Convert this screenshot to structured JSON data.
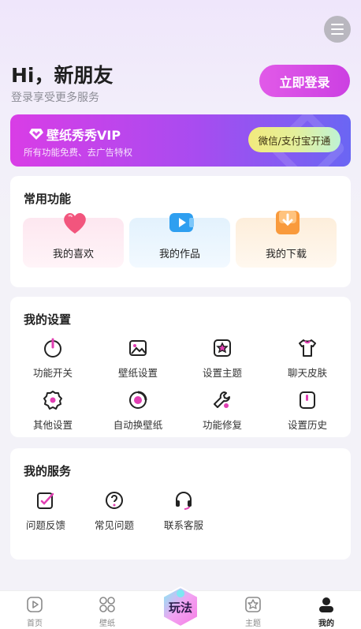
{
  "header": {
    "greeting": "Hi，新朋友",
    "subtitle": "登录享受更多服务",
    "login_label": "立即登录"
  },
  "vip": {
    "title": "壁纸秀秀VIP",
    "subtitle": "所有功能免费、去广告特权",
    "button_label": "微信/支付宝开通"
  },
  "common": {
    "title": "常用功能",
    "items": [
      {
        "label": "我的喜欢",
        "icon": "heart-icon"
      },
      {
        "label": "我的作品",
        "icon": "video-icon"
      },
      {
        "label": "我的下载",
        "icon": "download-icon"
      }
    ]
  },
  "settings": {
    "title": "我的设置",
    "items": [
      {
        "label": "功能开关",
        "icon": "power-icon"
      },
      {
        "label": "壁纸设置",
        "icon": "image-icon"
      },
      {
        "label": "设置主题",
        "icon": "theme-icon"
      },
      {
        "label": "聊天皮肤",
        "icon": "shirt-icon"
      },
      {
        "label": "其他设置",
        "icon": "gear-icon"
      },
      {
        "label": "自动换壁纸",
        "icon": "auto-change-icon"
      },
      {
        "label": "功能修复",
        "icon": "wrench-icon"
      },
      {
        "label": "设置历史",
        "icon": "history-icon"
      }
    ]
  },
  "services": {
    "title": "我的服务",
    "items": [
      {
        "label": "问题反馈",
        "icon": "feedback-icon"
      },
      {
        "label": "常见问题",
        "icon": "question-icon"
      },
      {
        "label": "联系客服",
        "icon": "headset-icon"
      }
    ]
  },
  "tabbar": {
    "items": [
      {
        "label": "首页",
        "icon": "home-icon"
      },
      {
        "label": "壁纸",
        "icon": "wallpaper-icon"
      },
      {
        "label": "玩法",
        "icon": "play-icon"
      },
      {
        "label": "主题",
        "icon": "theme-icon"
      },
      {
        "label": "我的",
        "icon": "profile-icon"
      }
    ],
    "active": "我的"
  }
}
